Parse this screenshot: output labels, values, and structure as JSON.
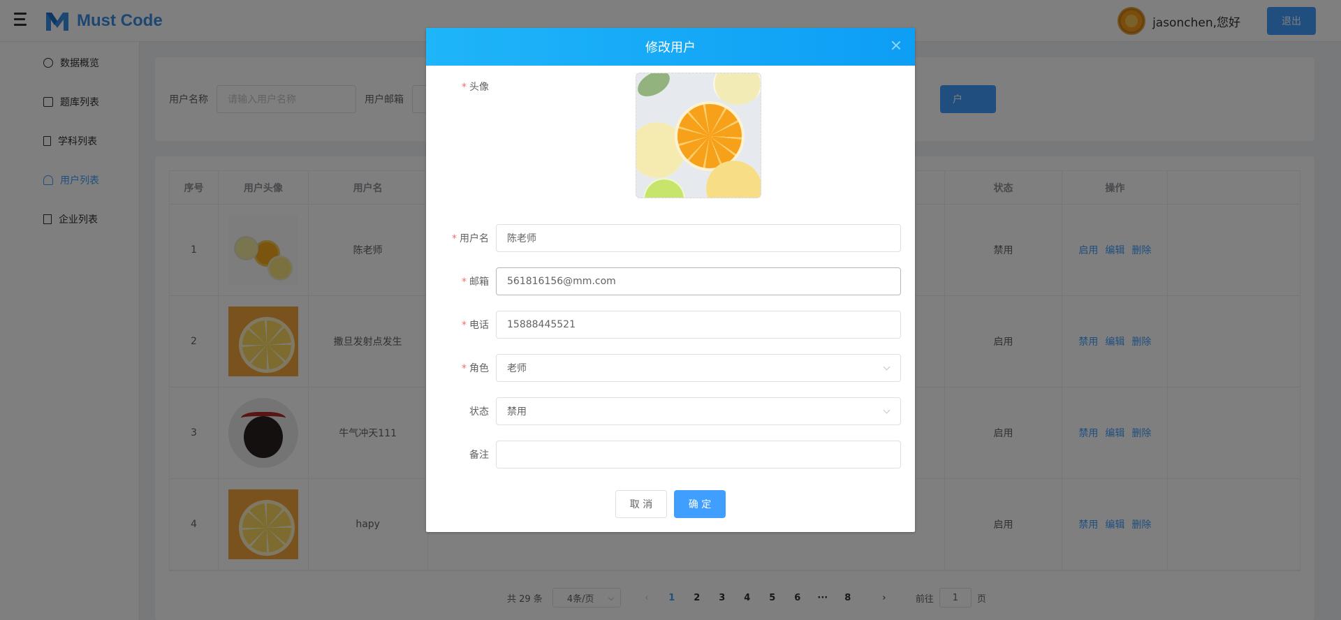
{
  "header": {
    "brand": "Must Code",
    "username": "jasonchen,您好",
    "logout_label": "退出"
  },
  "sidebar": {
    "items": [
      {
        "label": "数据概览",
        "icon": "pie-chart-icon"
      },
      {
        "label": "题库列表",
        "icon": "edit-icon"
      },
      {
        "label": "学科列表",
        "icon": "document-icon"
      },
      {
        "label": "用户列表",
        "icon": "user-icon"
      },
      {
        "label": "企业列表",
        "icon": "building-icon"
      }
    ],
    "active_index": 3
  },
  "search": {
    "username_label": "用户名称",
    "username_placeholder": "请输入用户名称",
    "email_label": "用户邮箱",
    "add_button_fragment": "户"
  },
  "table": {
    "headers": [
      "序号",
      "用户头像",
      "用户名",
      "状态",
      "操作"
    ],
    "rows": [
      {
        "index": "1",
        "name": "陈老师",
        "status": "禁用",
        "ops": [
          "启用",
          "编辑",
          "删除"
        ],
        "avatar": "citrus-slices"
      },
      {
        "index": "2",
        "name": "撒旦发射点发生",
        "status": "启用",
        "ops": [
          "禁用",
          "编辑",
          "删除"
        ],
        "avatar": "orange-slice"
      },
      {
        "index": "3",
        "name": "牛气冲天111",
        "status": "启用",
        "ops": [
          "禁用",
          "编辑",
          "删除"
        ],
        "avatar": "ox-mascot"
      },
      {
        "index": "4",
        "name": "hapy",
        "status": "启用",
        "ops": [
          "禁用",
          "编辑",
          "删除"
        ],
        "avatar": "orange-slice"
      }
    ]
  },
  "pagination": {
    "total": "共 29 条",
    "page_size": "4条/页",
    "pages": [
      "1",
      "2",
      "3",
      "4",
      "5",
      "6",
      "···",
      "8"
    ],
    "current": "1",
    "goto_label": "前往",
    "goto_value": "1",
    "page_suffix": "页"
  },
  "dialog": {
    "title": "修改用户",
    "fields": {
      "avatar_label": "头像",
      "username_label": "用户名",
      "username_value": "陈老师",
      "email_label": "邮箱",
      "email_value": "561816156@mm.com",
      "phone_label": "电话",
      "phone_value": "15888445521",
      "role_label": "角色",
      "role_value": "老师",
      "status_label": "状态",
      "status_value": "禁用",
      "remark_label": "备注",
      "remark_value": ""
    },
    "cancel_label": "取 消",
    "confirm_label": "确 定"
  },
  "colors": {
    "primary": "#409eff",
    "dialog_header": "#0d9ef5",
    "required_star": "#f56c6c"
  }
}
